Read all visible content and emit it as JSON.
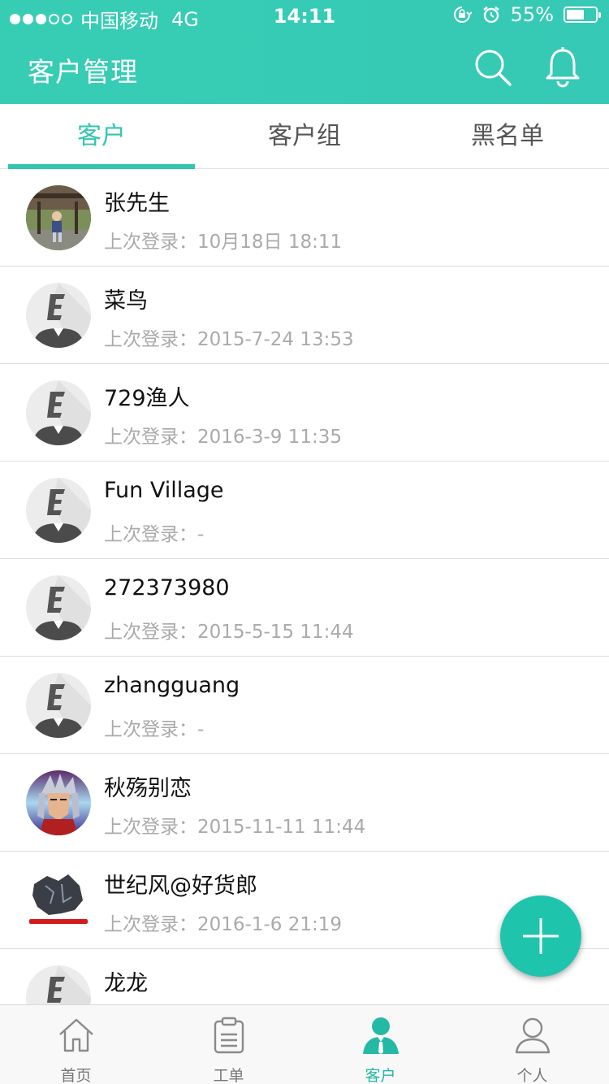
{
  "status_bar": {
    "carrier": "中国移动",
    "network": "4G",
    "time": "14:11",
    "battery": "55%",
    "battery_level": 0.55,
    "signal_dots_filled": 3,
    "signal_dots_total": 5
  },
  "header": {
    "title": "客户管理",
    "icons": [
      "search-icon",
      "bell-icon"
    ]
  },
  "tabs": [
    {
      "label": "客户",
      "active": true
    },
    {
      "label": "客户组",
      "active": false
    },
    {
      "label": "黑名单",
      "active": false
    }
  ],
  "customers": [
    {
      "name": "张先生",
      "login_label": "上次登录：",
      "login_value": "10月18日 18:11",
      "avatar": "photo"
    },
    {
      "name": "菜鸟",
      "login_label": "上次登录：",
      "login_value": "2015-7-24 13:53",
      "avatar": "default"
    },
    {
      "name": "729渔人",
      "login_label": "上次登录：",
      "login_value": "2016-3-9 11:35",
      "avatar": "default"
    },
    {
      "name": "Fun Village",
      "login_label": "上次登录：",
      "login_value": "-",
      "avatar": "default"
    },
    {
      "name": "272373980",
      "login_label": "上次登录：",
      "login_value": "2015-5-15 11:44",
      "avatar": "default"
    },
    {
      "name": "zhangguang",
      "login_label": "上次登录：",
      "login_value": "-",
      "avatar": "default"
    },
    {
      "name": "秋殇别恋",
      "login_label": "上次登录：",
      "login_value": "2015-11-11 11:44",
      "avatar": "anime"
    },
    {
      "name": "世纪风@好货郎",
      "login_label": "上次登录：",
      "login_value": "2016-1-6 21:19",
      "avatar": "logo"
    },
    {
      "name": "龙龙",
      "login_label": "",
      "login_value": "",
      "avatar": "default"
    }
  ],
  "fab": {
    "icon": "plus-icon"
  },
  "tabbar": [
    {
      "label": "首页",
      "icon": "home-icon",
      "active": false
    },
    {
      "label": "工单",
      "icon": "clipboard-icon",
      "active": false
    },
    {
      "label": "客户",
      "icon": "customer-icon",
      "active": true
    },
    {
      "label": "个人",
      "icon": "person-icon",
      "active": false
    }
  ],
  "colors": {
    "accent": "#33c6af",
    "header_bg": "#37cdb4",
    "fab": "#1fc4ad",
    "secondary_text": "#aaaaaa"
  }
}
